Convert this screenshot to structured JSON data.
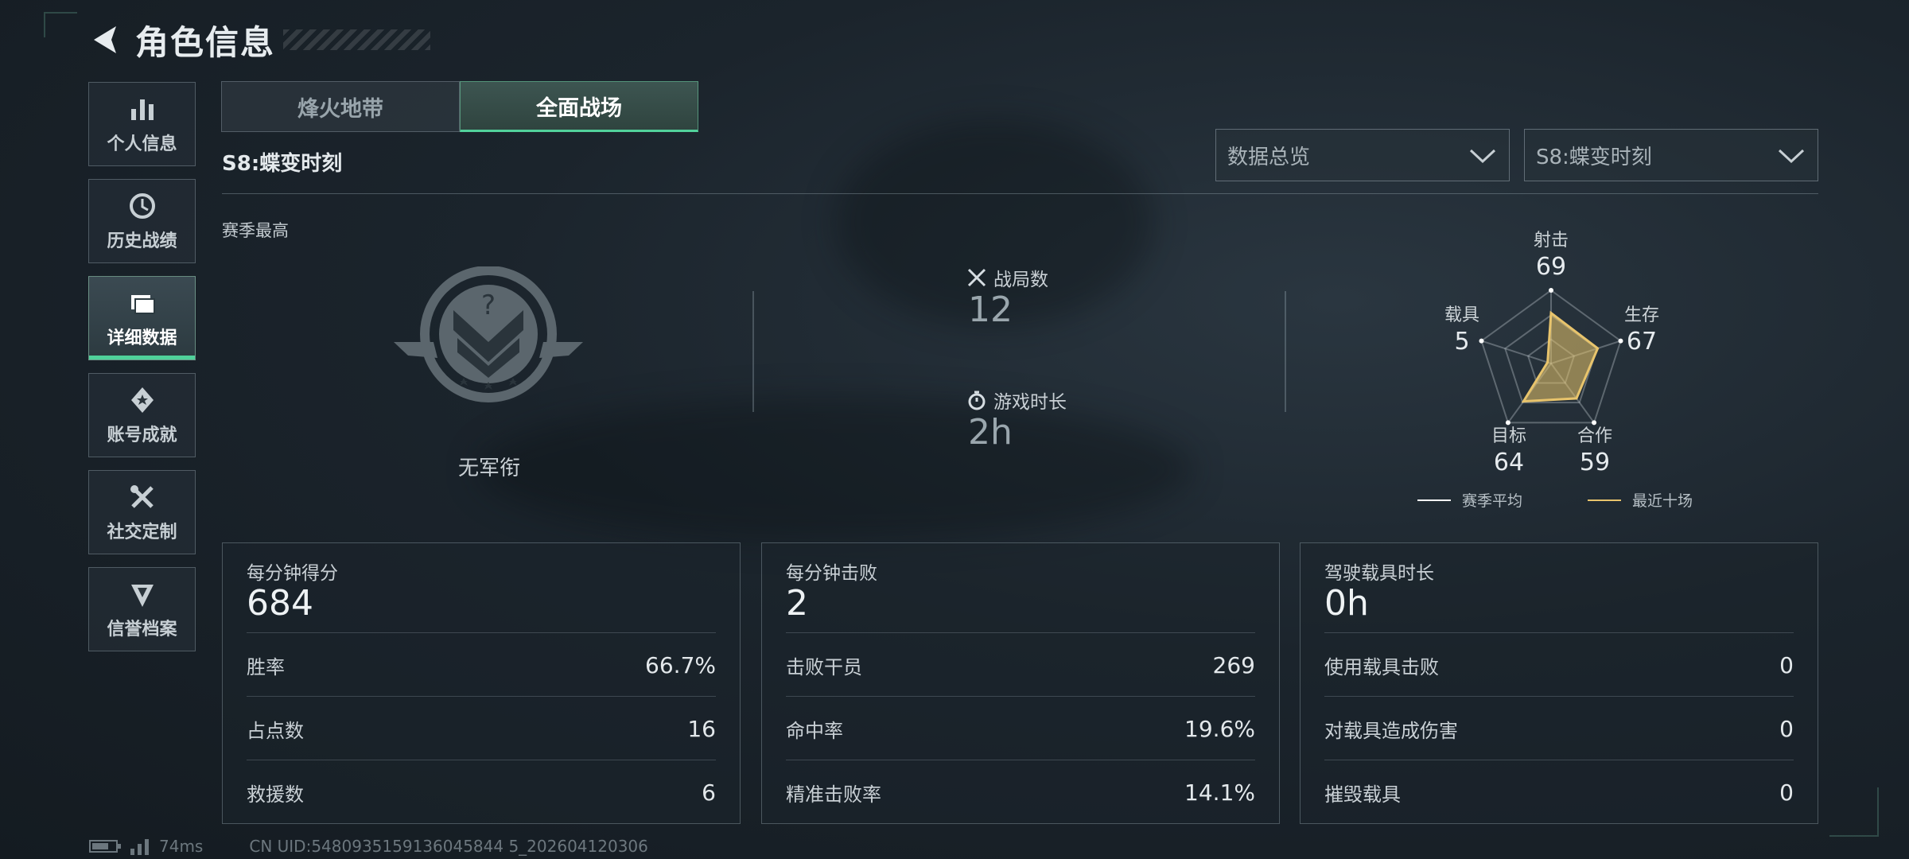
{
  "header": {
    "title": "角色信息"
  },
  "sidebar": {
    "items": [
      {
        "label": "个人信息",
        "icon": "bar-chart-icon"
      },
      {
        "label": "历史战绩",
        "icon": "history-clock-icon"
      },
      {
        "label": "详细数据",
        "icon": "folder-icon",
        "active": true
      },
      {
        "label": "账号成就",
        "icon": "achievement-icon"
      },
      {
        "label": "社交定制",
        "icon": "tools-icon"
      },
      {
        "label": "信誉档案",
        "icon": "reputation-shield-icon"
      }
    ]
  },
  "tabs": [
    {
      "label": "烽火地带"
    },
    {
      "label": "全面战场",
      "active": true
    }
  ],
  "season_title": "S8:蝶变时刻",
  "filters": {
    "view": "数据总览",
    "season": "S8:蝶变时刻"
  },
  "season_best": {
    "label": "赛季最高",
    "rank": "无军衔"
  },
  "stats": {
    "matches": {
      "label": "战局数",
      "value": "12"
    },
    "playtime": {
      "label": "游戏时长",
      "value": "2h"
    }
  },
  "radar": {
    "axes": [
      {
        "label": "射击",
        "value": "69"
      },
      {
        "label": "生存",
        "value": "67"
      },
      {
        "label": "合作",
        "value": "59"
      },
      {
        "label": "目标",
        "value": "64"
      },
      {
        "label": "载具",
        "value": "5"
      }
    ],
    "legend": {
      "season_avg": "赛季平均",
      "recent_ten": "最近十场"
    },
    "colors": {
      "recent": "#e8c46c",
      "avg": "#ffffff"
    }
  },
  "cards": [
    {
      "title": "每分钟得分",
      "value": "684",
      "rows": [
        {
          "k": "胜率",
          "v": "66.7%"
        },
        {
          "k": "占点数",
          "v": "16"
        },
        {
          "k": "救援数",
          "v": "6"
        }
      ]
    },
    {
      "title": "每分钟击败",
      "value": "2",
      "rows": [
        {
          "k": "击败干员",
          "v": "269"
        },
        {
          "k": "命中率",
          "v": "19.6%"
        },
        {
          "k": "精准击败率",
          "v": "14.1%"
        }
      ]
    },
    {
      "title": "驾驶载具时长",
      "value": "0h",
      "rows": [
        {
          "k": "使用载具击败",
          "v": "0"
        },
        {
          "k": "对载具造成伤害",
          "v": "0"
        },
        {
          "k": "摧毁载具",
          "v": "0"
        }
      ]
    }
  ],
  "footer": {
    "ping": "74ms",
    "uid": "CN UID:5480935159136045844 5_202604120306"
  }
}
